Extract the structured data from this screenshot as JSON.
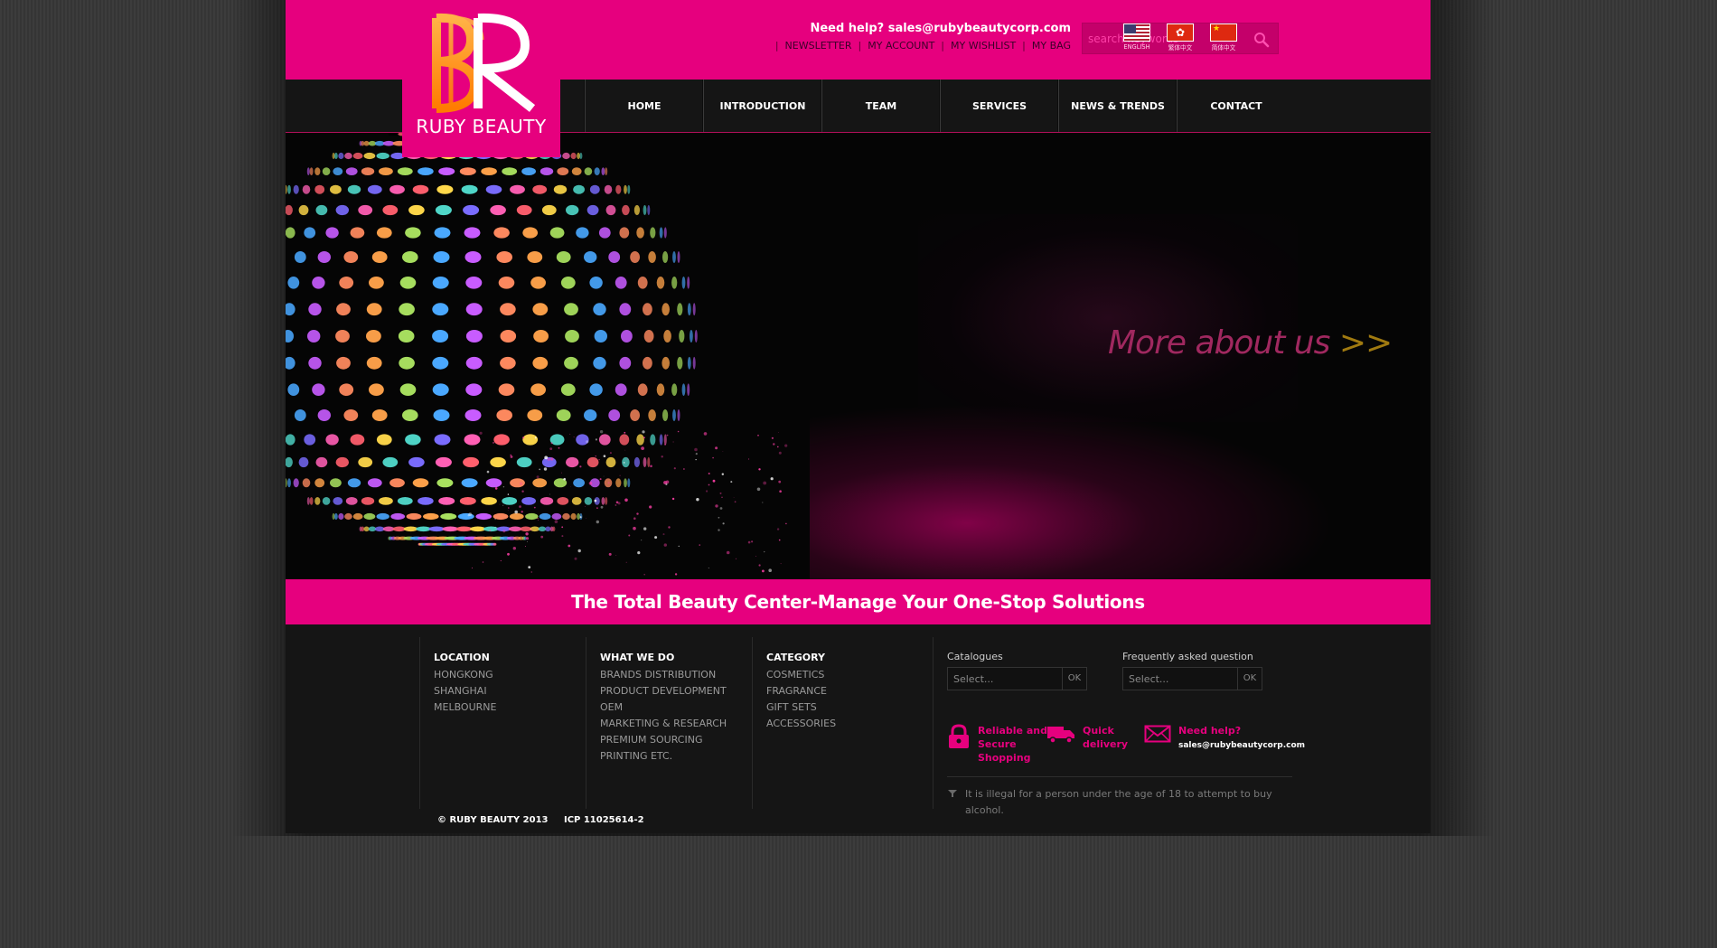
{
  "brand": {
    "logo_text": "RUBY BEAUTY",
    "logo_letters": "BR",
    "accent": "#e6007e"
  },
  "header": {
    "help_prefix": "Need help?",
    "help_email": "sales@rubybeautycorp.com",
    "links": [
      "NEWSLETTER",
      "MY ACCOUNT",
      "MY WISHLIST",
      "MY BAG"
    ],
    "search_placeholder": "search keywords",
    "languages": [
      {
        "label": "ENGLISH",
        "icon": "us-flag-icon"
      },
      {
        "label": "繁体中文",
        "icon": "hk-flag-icon"
      },
      {
        "label": "简体中文",
        "icon": "cn-flag-icon"
      }
    ]
  },
  "nav": {
    "items": [
      "HOME",
      "INTRODUCTION",
      "TEAM",
      "SERVICES",
      "NEWS & TRENDS",
      "CONTACT"
    ]
  },
  "banner": {
    "more_text": "More about us",
    "more_arrow": ">>"
  },
  "tagline": "The Total Beauty Center-Manage Your One-Stop Solutions",
  "footer": {
    "columns": [
      {
        "title": "LOCATION",
        "items": [
          "HONGKONG",
          "SHANGHAI",
          "MELBOURNE"
        ]
      },
      {
        "title": "WHAT WE DO",
        "items": [
          "BRANDS DISTRIBUTION",
          "PRODUCT DEVELOPMENT",
          "OEM",
          "MARKETING & RESEARCH",
          "PREMIUM SOURCING",
          "PRINTING ETC."
        ]
      },
      {
        "title": "CATEGORY",
        "items": [
          "COSMETICS",
          "FRAGRANCE",
          "GIFT SETS",
          "ACCESSORIES"
        ]
      }
    ],
    "catalogues": {
      "label": "Catalogues",
      "placeholder": "Select...",
      "ok": "OK"
    },
    "faq": {
      "label": "Frequently asked question",
      "placeholder": "Select...",
      "ok": "OK"
    },
    "features": [
      {
        "icon": "lock-icon",
        "lines": [
          "Reliable and",
          "Secure",
          "Shopping"
        ]
      },
      {
        "icon": "truck-icon",
        "lines": [
          "Quick",
          "delivery"
        ]
      },
      {
        "icon": "envelope-icon",
        "lines": [
          "Need help?"
        ],
        "email": "sales@rubybeautycorp.com"
      }
    ],
    "legal": "It is illegal for a person under the age of 18 to attempt to buy alcohol.",
    "copyright": "© RUBY BEAUTY 2013",
    "icp": "ICP 11025614-2"
  }
}
